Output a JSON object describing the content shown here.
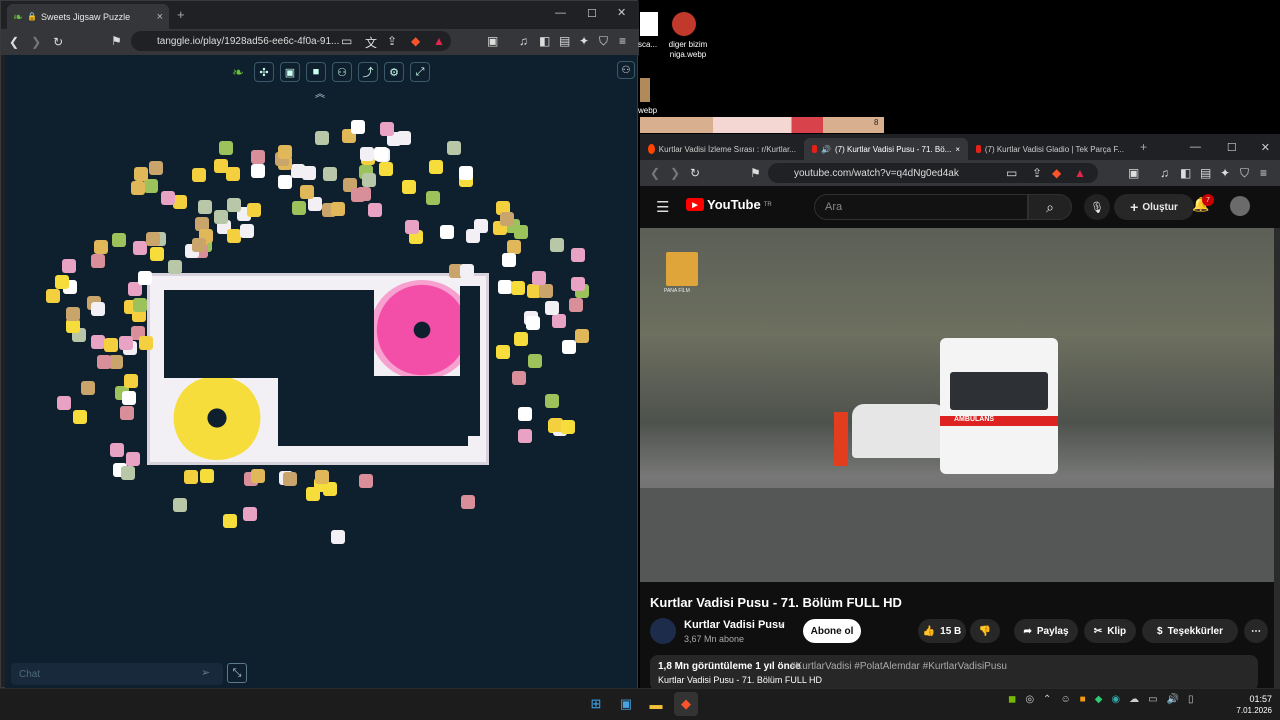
{
  "left_window": {
    "tab_title": "Sweets Jigsaw Puzzle",
    "url": "tanggle.io/play/1928ad56-ee6c-4f0a-91...",
    "chat_placeholder": "Chat"
  },
  "desktop": {
    "file1_label": "sca...",
    "file2_label": "diger bizim niga.webp",
    "file3_label": "webp",
    "preview_count": "8"
  },
  "right_window": {
    "tabs": [
      {
        "label": "Kurtlar Vadisi İzleme Sırası : r/Kurtlar..."
      },
      {
        "label": "(7) Kurtlar Vadisi Pusu - 71. Bö..."
      },
      {
        "label": "(7) Kurtlar Vadisi Gladio | Tek Parça F..."
      }
    ],
    "url": "youtube.com/watch?v=q4dNg0ed4ak",
    "youtube": {
      "logo_text": "YouTube",
      "logo_region": "TR",
      "search_placeholder": "Ara",
      "create_label": "Oluştur",
      "notification_count": "7",
      "video_title": "Kurtlar Vadisi Pusu - 71. Bölüm FULL HD",
      "channel_name": "Kurtlar Vadisi Pusu",
      "subscribers": "3,67 Mn abone",
      "subscribe_label": "Abone ol",
      "likes": "15 B",
      "share_label": "Paylaş",
      "clip_label": "Klip",
      "thanks_label": "Teşekkürler",
      "views_line": "1,8 Mn görüntüleme  1 yıl önce",
      "tags": "#KurtlarVadisi #PolatAlemdar #KurtlarVadisiPusu",
      "description": "Kurtlar Vadisi Pusu - 71. Bölüm FULL HD",
      "video_overlay_logo": "PANA FİLM",
      "ambulance_text": "AMBULANS"
    }
  },
  "taskbar": {
    "time": "01:57",
    "date": "7.01.2026"
  },
  "colors": {
    "puzzle_bg": "#0e1f2e",
    "youtube_red": "#ff0000",
    "browser_dark": "#202124"
  }
}
